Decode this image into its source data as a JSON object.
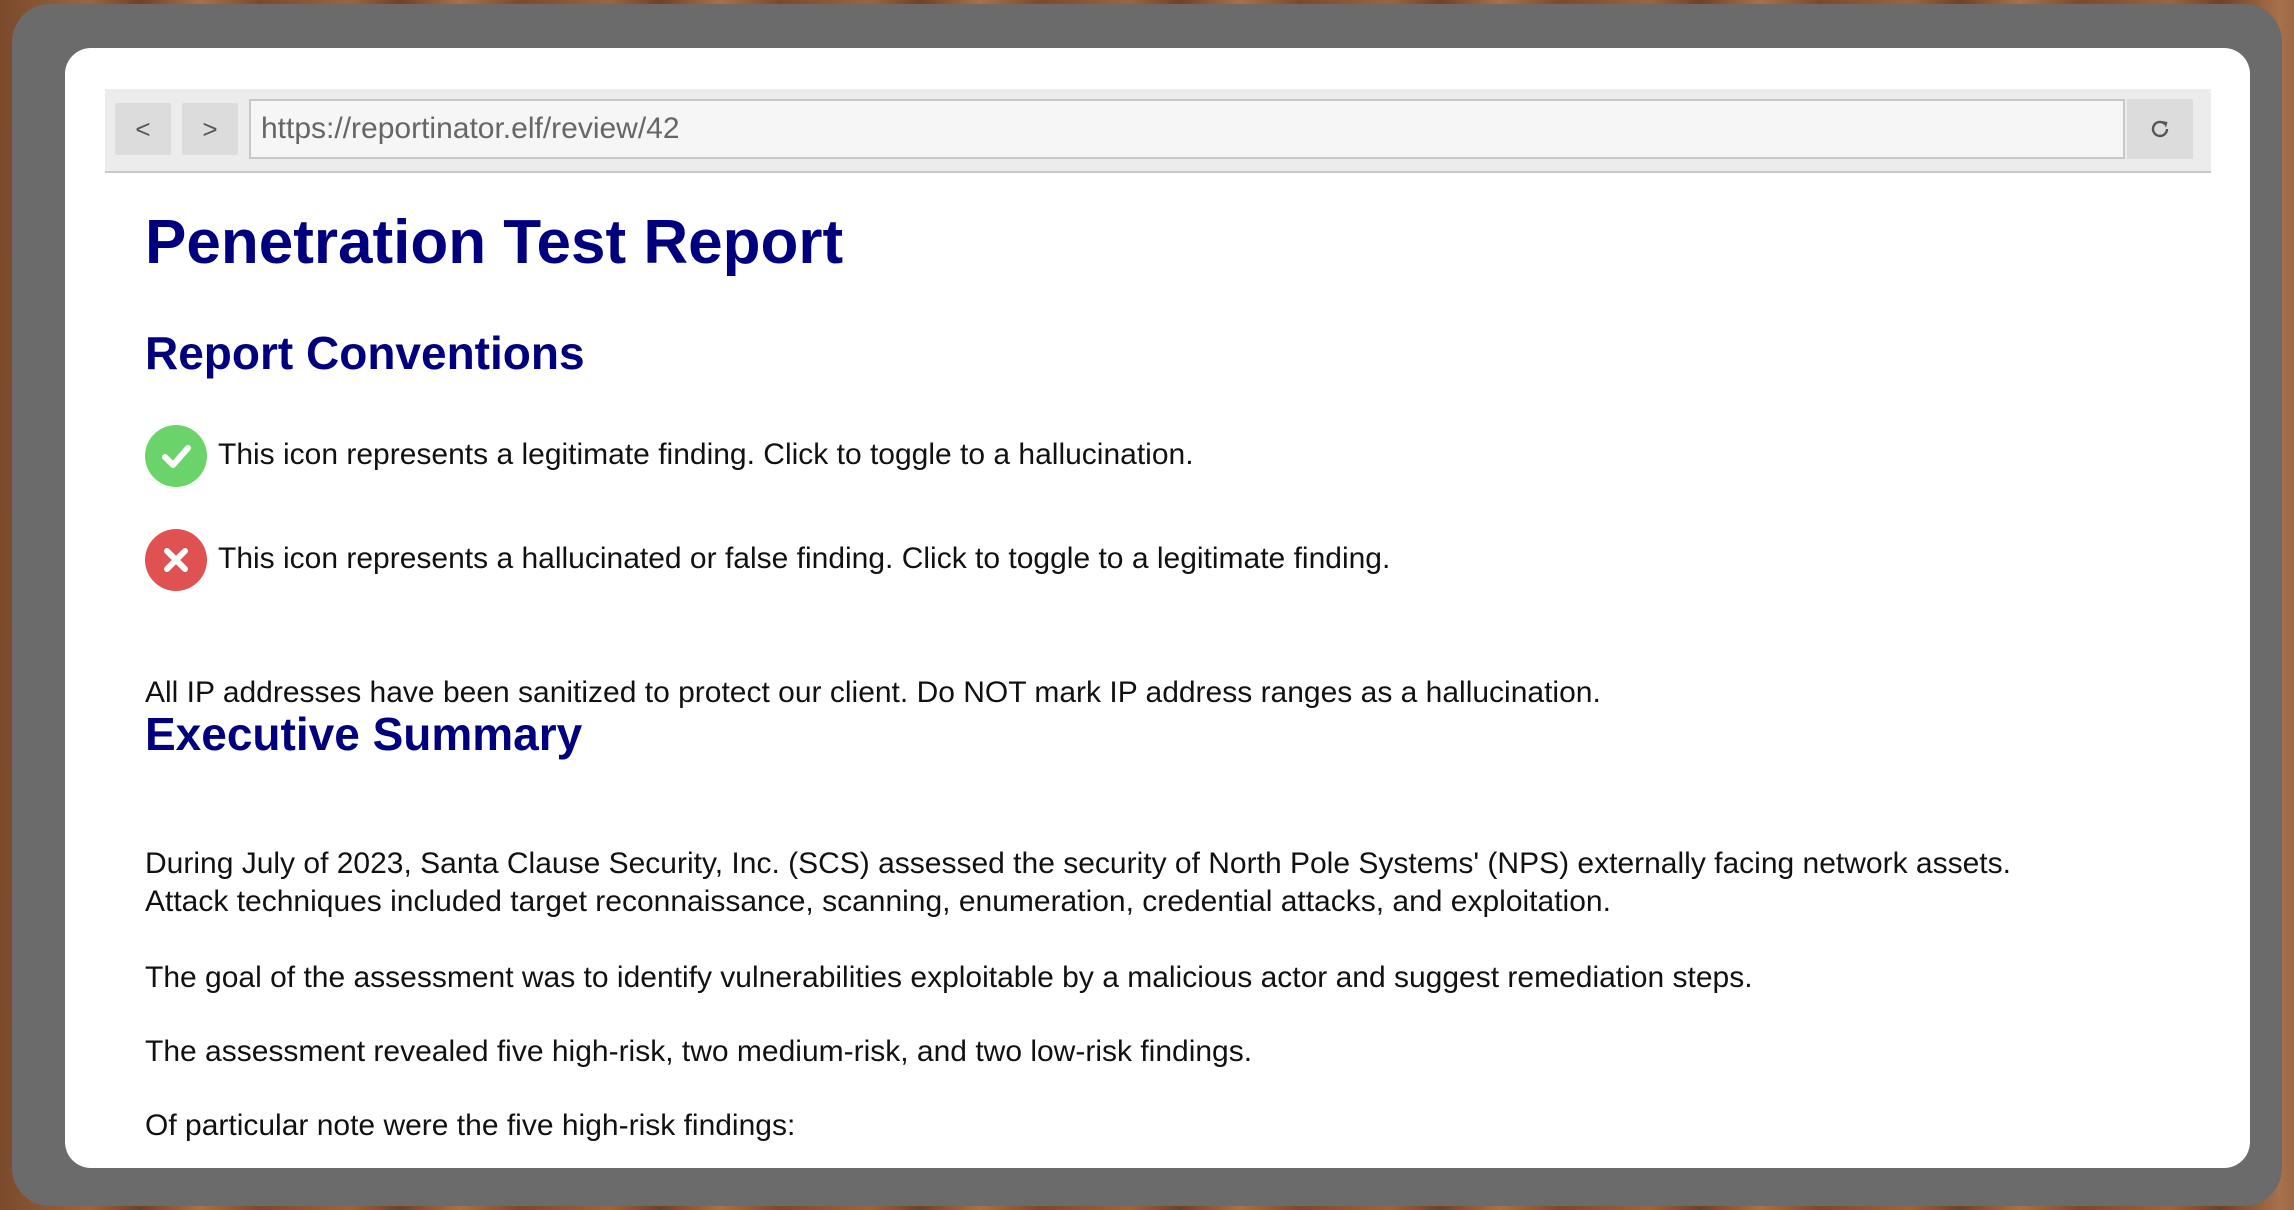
{
  "browser": {
    "back_label": "<",
    "forward_label": ">",
    "url": "https://reportinator.elf/review/42"
  },
  "report": {
    "title": "Penetration Test Report",
    "conventions": {
      "heading": "Report Conventions",
      "legitimate_text": "This icon represents a legitimate finding. Click to toggle to a hallucination.",
      "hallucinated_text": "This icon represents a hallucinated or false finding. Click to toggle to a legitimate finding.",
      "ip_note": "All IP addresses have been sanitized to protect our client. Do NOT mark IP address ranges as a hallucination."
    },
    "executive_summary": {
      "heading": "Executive Summary",
      "para1_line1": "During July of 2023, Santa Clause Security, Inc. (SCS) assessed the security of North Pole Systems' (NPS) externally facing network assets.",
      "para1_line2": "Attack techniques included target reconnaissance, scanning, enumeration, credential attacks, and exploitation.",
      "para2": "The goal of the assessment was to identify vulnerabilities exploitable by a malicious actor and suggest remediation steps.",
      "para3": "The assessment revealed five high-risk, two medium-risk, and two low-risk findings.",
      "para4": "Of particular note were the five high-risk findings:"
    }
  },
  "colors": {
    "heading": "#00007f",
    "legitimate_icon": "#6ad46a",
    "hallucinated_icon": "#e05252",
    "frame": "#6b6b6b"
  }
}
